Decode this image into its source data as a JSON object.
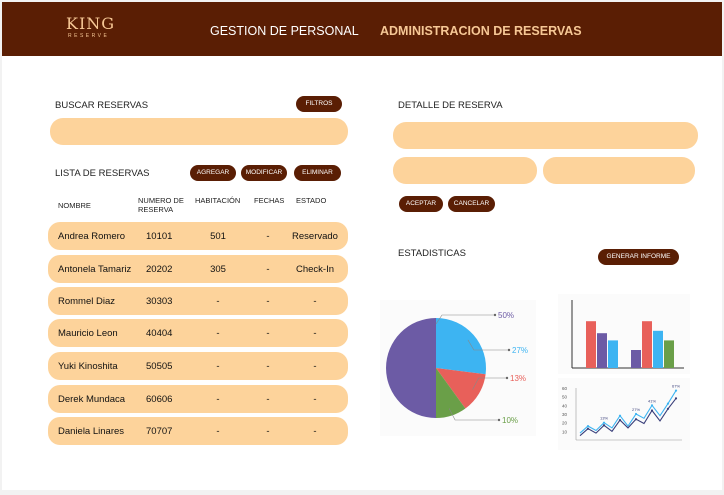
{
  "header": {
    "logo_main": "KING",
    "logo_sub": "RESERVE",
    "nav": [
      "GESTION DE PERSONAL",
      "ADMINISTRACION DE RESERVAS"
    ]
  },
  "search": {
    "title": "BUSCAR RESERVAS",
    "filters_label": "FILTROS",
    "value": ""
  },
  "list": {
    "title": "LISTA DE RESERVAS",
    "actions": {
      "add": "AGREGAR",
      "edit": "MODIFICAR",
      "delete": "ELIMINAR"
    },
    "columns": [
      "NOMBRE",
      "NUMERO DE RESERVA",
      "HABITACIÓN",
      "FECHAS",
      "ESTADO"
    ],
    "rows": [
      {
        "name": "Andrea Romero",
        "number": "10101",
        "room": "501",
        "dates": "-",
        "status": "Reservado"
      },
      {
        "name": "Antonela Tamariz",
        "number": "20202",
        "room": "305",
        "dates": "-",
        "status": "Check-In"
      },
      {
        "name": "Rommel Diaz",
        "number": "30303",
        "room": "-",
        "dates": "-",
        "status": "-"
      },
      {
        "name": "Mauricio Leon",
        "number": "40404",
        "room": "-",
        "dates": "-",
        "status": "-"
      },
      {
        "name": "Yuki Kinoshita",
        "number": "50505",
        "room": "-",
        "dates": "-",
        "status": "-"
      },
      {
        "name": "Derek Mundaca",
        "number": "60606",
        "room": "-",
        "dates": "-",
        "status": "-"
      },
      {
        "name": "Daniela Linares",
        "number": "70707",
        "room": "-",
        "dates": "-",
        "status": "-"
      }
    ]
  },
  "detail": {
    "title": "DETALLE DE RESERVA",
    "accept": "ACEPTAR",
    "cancel": "CANCELAR"
  },
  "stats": {
    "title": "ESTADISTICAS",
    "report_button": "GENERAR INFORME",
    "pie": {
      "slices": [
        {
          "label": "50%",
          "value": 50,
          "color": "#6c5ba5"
        },
        {
          "label": "27%",
          "value": 27,
          "color": "#3db4f2"
        },
        {
          "label": "13%",
          "value": 13,
          "color": "#e8605a"
        },
        {
          "label": "10%",
          "value": 10,
          "color": "#6a9f48"
        }
      ]
    },
    "bars": {
      "groups": [
        {
          "values": [
            0.78,
            0.58,
            0.46
          ],
          "colors": [
            "#e8605a",
            "#6c5ba5",
            "#3db4f2"
          ]
        },
        {
          "values": [
            0.3,
            0.78,
            0.62,
            0.46
          ],
          "colors": [
            "#6c5ba5",
            "#e8605a",
            "#3db4f2",
            "#6a9f48"
          ]
        }
      ]
    },
    "line": {
      "y_ticks": [
        "60",
        "50",
        "40",
        "30",
        "20",
        "10"
      ],
      "point_labels": [
        "13%",
        "27%",
        "41%",
        "67%"
      ],
      "series": [
        {
          "color": "#3db4f2",
          "values": [
            8,
            16,
            11,
            20,
            14,
            28,
            16,
            30,
            25,
            40,
            28,
            42,
            57
          ]
        },
        {
          "color": "#3a3f7a",
          "values": [
            5,
            13,
            8,
            17,
            10,
            23,
            14,
            24,
            19,
            34,
            22,
            36,
            48
          ]
        }
      ]
    }
  }
}
